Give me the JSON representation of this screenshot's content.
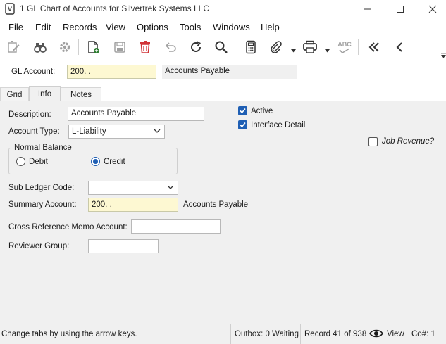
{
  "window": {
    "title": "1 GL Chart of Accounts for Silvertrek Systems LLC",
    "minimize": "—",
    "maximize": "□",
    "close": "✕"
  },
  "menu": [
    "File",
    "Edit",
    "Records",
    "View",
    "Options",
    "Tools",
    "Windows",
    "Help"
  ],
  "toolbar": {
    "icons": [
      "edit-icon",
      "find-icon",
      "settings-icon",
      "new-record-icon",
      "save-icon",
      "delete-icon",
      "undo-icon",
      "refresh-icon",
      "search-icon",
      "calculator-icon",
      "attach-icon",
      "print-icon",
      "spellcheck-icon",
      "first-record-icon",
      "previous-record-icon"
    ],
    "spellcheck_text": "ABC"
  },
  "header": {
    "gl_account_label": "GL Account:",
    "gl_account_value": "200.  .",
    "gl_account_name": "Accounts Payable"
  },
  "tabs": [
    {
      "label": "Grid",
      "active": false
    },
    {
      "label": "Info",
      "active": true
    },
    {
      "label": "Notes",
      "active": false
    }
  ],
  "info": {
    "description_label": "Description:",
    "description_value": "Accounts Payable",
    "account_type_label": "Account Type:",
    "account_type_value": "L-Liability",
    "active_label": "Active",
    "active_checked": true,
    "interface_detail_label": "Interface Detail",
    "interface_detail_checked": true,
    "job_revenue_label": "Job Revenue?",
    "job_revenue_checked": false,
    "normal_balance_label": "Normal Balance",
    "debit_label": "Debit",
    "credit_label": "Credit",
    "normal_balance_selected": "Credit",
    "sub_ledger_label": "Sub Ledger Code:",
    "sub_ledger_value": "",
    "summary_account_label": "Summary Account:",
    "summary_account_value": "200.  .",
    "summary_account_name": "Accounts Payable",
    "cross_ref_label": "Cross Reference Memo Account:",
    "cross_ref_value": "",
    "reviewer_group_label": "Reviewer Group:",
    "reviewer_group_value": ""
  },
  "status": {
    "hint": "Change tabs by using the arrow keys.",
    "outbox": "Outbox: 0 Waiting",
    "record": "Record 41 of 938",
    "view": "View",
    "company": "Co#: 1"
  },
  "colors": {
    "accent": "#1f5fb4",
    "required_field": "#fdf8d2",
    "panel": "#f0f0f0",
    "delete_red": "#d13438"
  }
}
